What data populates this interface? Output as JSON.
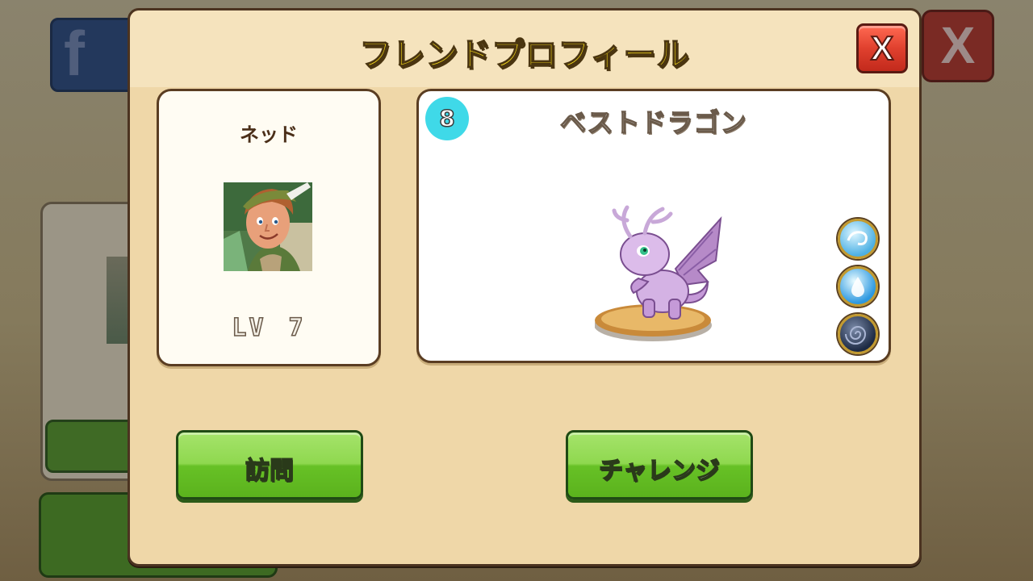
{
  "background": {
    "facebook_glyph": "f",
    "close_glyph": "X"
  },
  "dialog": {
    "title": "フレンドプロフィール",
    "close_label": "X"
  },
  "friend": {
    "name": "ネッド",
    "level_prefix": "LV",
    "level": "7",
    "avatar_icon": "friend-portrait"
  },
  "dragon": {
    "section_title": "ベストドラゴン",
    "level_badge": "8",
    "elements": [
      "wind-element-icon",
      "water-element-icon",
      "dark-element-icon"
    ]
  },
  "buttons": {
    "visit": "訪問",
    "challenge": "チャレンジ"
  },
  "colors": {
    "title_yellow": "#ffe21a",
    "close_red": "#e0402e",
    "button_green": "#67c126",
    "badge_cyan": "#3fd9e8",
    "panel_beige": "#efd7a8"
  }
}
